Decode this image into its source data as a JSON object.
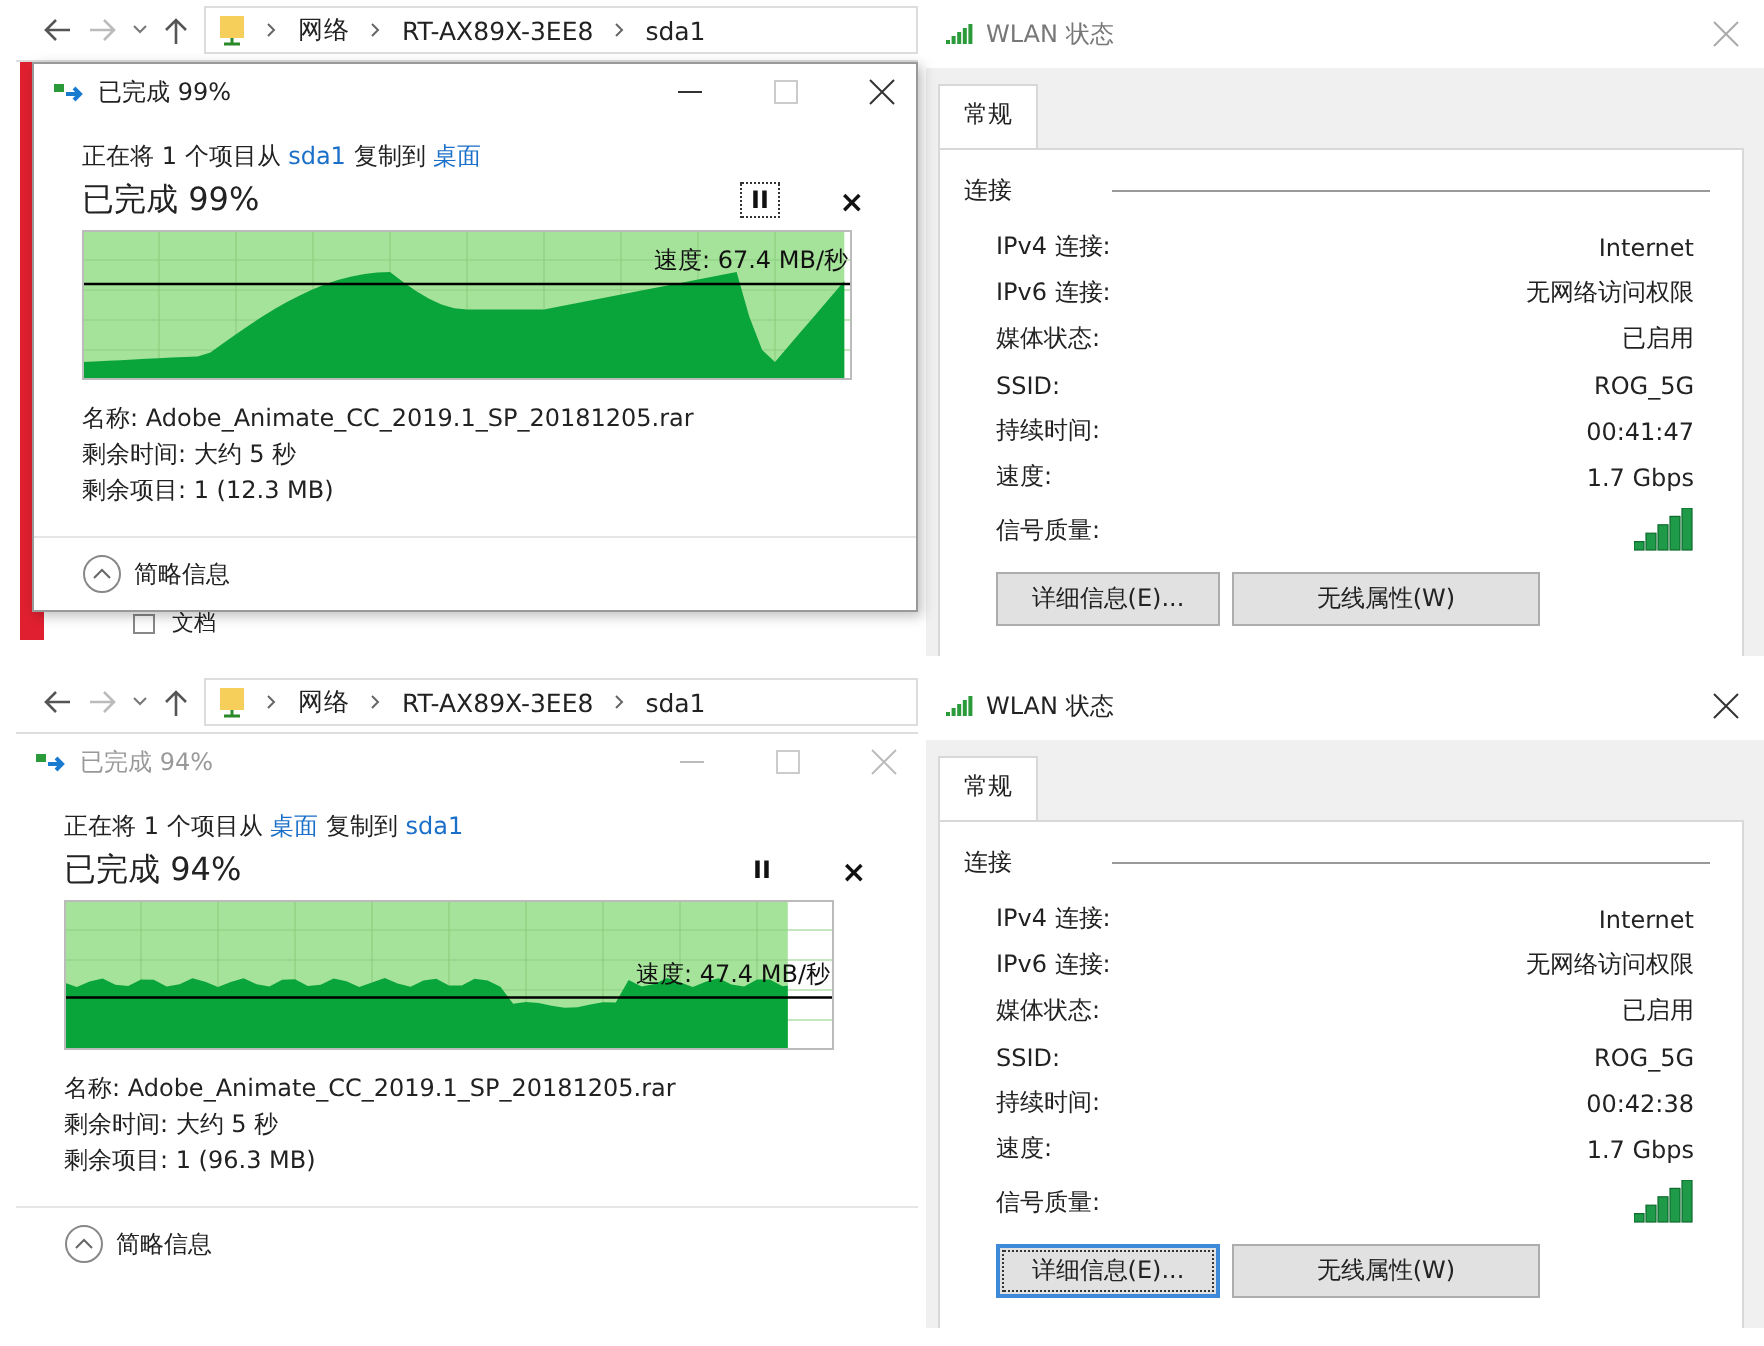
{
  "panels": [
    {
      "explorer": {
        "path": [
          "网络",
          "RT-AX89X-3EE8",
          "sda1"
        ],
        "item_below": "文档"
      },
      "copy_dialog": {
        "title": "已完成 99%",
        "active": true,
        "desc_prefix": "正在将 1 个项目从",
        "from": "sda1",
        "desc_middle": "复制到",
        "to": "桌面",
        "progress_text": "已完成 99%",
        "pause_focused": true,
        "pause_glyph": "II",
        "cancel_glyph": "×",
        "level": 0.99,
        "speed": "速度: 67.4 MB/秒",
        "name": "名称: Adobe_Animate_CC_2019.1_SP_20181205.rar",
        "time_left": "剩余时间: 大约 5 秒",
        "items_left": "剩余项目: 1 (12.3 MB)",
        "toggle": "简略信息"
      },
      "wlan": {
        "title": "WLAN 状态",
        "tab": {
          "label": "常规",
          "selected": true
        },
        "group": "连接",
        "rows": [
          {
            "label": "IPv4 连接:",
            "value": "Internet"
          },
          {
            "label": "IPv6 连接:",
            "value": "无网络访问权限"
          },
          {
            "label": "媒体状态:",
            "value": "已启用"
          },
          {
            "label": "SSID:",
            "value": "ROG_5G"
          },
          {
            "label": "持续时间:",
            "value": "00:41:47"
          },
          {
            "label": "速度:",
            "value": "1.7 Gbps"
          }
        ],
        "signal_label": "信号质量:",
        "buttons": [
          {
            "label": "详细信息(E)...",
            "focused": false
          },
          {
            "label": "无线属性(W)",
            "focused": false
          }
        ]
      }
    },
    {
      "explorer": {
        "path": [
          "网络",
          "RT-AX89X-3EE8",
          "sda1"
        ]
      },
      "copy_dialog": {
        "title": "已完成 94%",
        "active": false,
        "desc_prefix": "正在将 1 个项目从",
        "from": "桌面",
        "desc_middle": "复制到",
        "to": "sda1",
        "progress_text": "已完成 94%",
        "pause_focused": false,
        "pause_glyph": "II",
        "cancel_glyph": "×",
        "level": 0.94,
        "speed": "速度: 47.4 MB/秒",
        "name": "名称: Adobe_Animate_CC_2019.1_SP_20181205.rar",
        "time_left": "剩余时间: 大约 5 秒",
        "items_left": "剩余项目: 1 (96.3 MB)",
        "toggle": "简略信息"
      },
      "wlan": {
        "title": "WLAN 状态",
        "tab": {
          "label": "常规",
          "selected": true
        },
        "group": "连接",
        "rows": [
          {
            "label": "IPv4 连接:",
            "value": "Internet"
          },
          {
            "label": "IPv6 连接:",
            "value": "无网络访问权限"
          },
          {
            "label": "媒体状态:",
            "value": "已启用"
          },
          {
            "label": "SSID:",
            "value": "ROG_5G"
          },
          {
            "label": "持续时间:",
            "value": "00:42:38"
          },
          {
            "label": "速度:",
            "value": "1.7 Gbps"
          }
        ],
        "signal_label": "信号质量:",
        "buttons": [
          {
            "label": "详细信息(E)...",
            "focused": true
          },
          {
            "label": "无线属性(W)",
            "focused": false
          }
        ]
      }
    }
  ]
}
